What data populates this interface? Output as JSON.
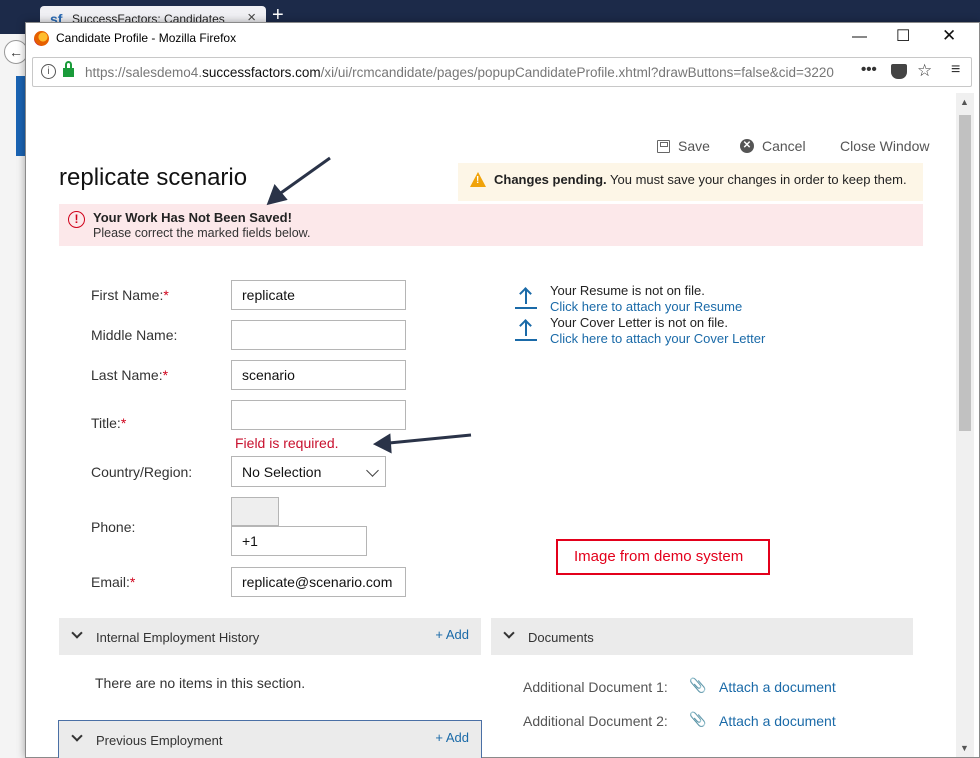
{
  "background_browser": {
    "tab_title": "SuccessFactors: Candidates",
    "tab_logo": "sf"
  },
  "window": {
    "title": "Candidate Profile - Mozilla Firefox",
    "url_prefix": "https://salesdemo4.",
    "url_host": "successfactors.com",
    "url_path": "/xi/ui/rcmcandidate/pages/popupCandidateProfile.xhtml?drawButtons=false&cid=3220"
  },
  "toolbar": {
    "save_label": "Save",
    "cancel_label": "Cancel",
    "close_label": "Close Window"
  },
  "page": {
    "title": "replicate scenario"
  },
  "pending": {
    "bold": "Changes pending.",
    "text": " You must save your changes in order to keep them."
  },
  "error": {
    "title": "Your Work Has Not Been Saved!",
    "subtitle": "Please correct the marked fields below."
  },
  "form": {
    "first_name": {
      "label": "First Name:",
      "required": "*",
      "value": "replicate"
    },
    "middle_name": {
      "label": "Middle Name:",
      "value": ""
    },
    "last_name": {
      "label": "Last Name:",
      "required": "*",
      "value": "scenario"
    },
    "title": {
      "label": "Title:",
      "required": "*",
      "value": "",
      "error": "Field is required."
    },
    "country": {
      "label": "Country/Region:",
      "value": "No Selection"
    },
    "phone": {
      "label": "Phone:",
      "value": "+1"
    },
    "email": {
      "label": "Email:",
      "required": "*",
      "value": "replicate@scenario.com"
    }
  },
  "attachments": {
    "resume_status": "Your Resume is not on file.",
    "resume_link": "Click here to attach your Resume",
    "cover_status": "Your Cover Letter is not on file.",
    "cover_link": "Click here to attach your Cover Letter"
  },
  "annotation": {
    "demo_label": "Image from demo system"
  },
  "sections": {
    "internal": {
      "title": "Internal Employment History",
      "add": "+ Add",
      "empty": "There are no items in this section."
    },
    "documents": {
      "title": "Documents",
      "items": [
        {
          "label": "Additional Document 1:",
          "link": "Attach a document"
        },
        {
          "label": "Additional Document 2:",
          "link": "Attach a document"
        }
      ]
    },
    "previous": {
      "title": "Previous Employment",
      "add": "+ Add"
    }
  },
  "colors": {
    "link": "#1a6aa8",
    "error": "#c8102e",
    "warning": "#f0a30a",
    "error_bg": "#fce8ea",
    "pending_bg": "#fdf6e7"
  }
}
